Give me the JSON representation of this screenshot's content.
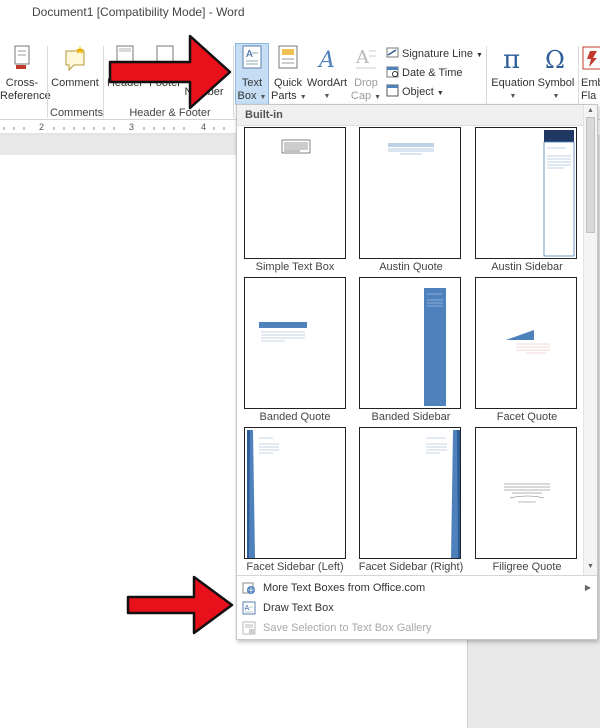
{
  "window": {
    "title": "Document1 [Compatibility Mode] - Word"
  },
  "ribbon": {
    "cross_reference": {
      "line1": "Cross-",
      "line2": "Reference"
    },
    "comment": {
      "label": "Comment"
    },
    "header": {
      "label": "Header"
    },
    "footer": {
      "label": "Footer"
    },
    "page_number": {
      "label": "Number"
    },
    "text_box": {
      "line1": "Text",
      "line2": "Box"
    },
    "quick_parts": {
      "line1": "Quick",
      "line2": "Parts"
    },
    "wordart": {
      "label": "WordArt"
    },
    "drop_cap": {
      "line1": "Drop",
      "line2": "Cap"
    },
    "signature_line": {
      "label": "Signature Line"
    },
    "date_time": {
      "label": "Date & Time"
    },
    "object": {
      "label": "Object"
    },
    "equation": {
      "label": "Equation"
    },
    "symbol": {
      "label": "Symbol"
    },
    "embed": {
      "line1": "Emb",
      "line2": "Fla"
    },
    "groups": {
      "comments": "Comments",
      "header_footer": "Header & Footer"
    }
  },
  "ruler": {
    "marks": [
      "2",
      "3",
      "4"
    ]
  },
  "gallery": {
    "section": "Built-in",
    "items": [
      {
        "label": "Simple Text Box"
      },
      {
        "label": "Austin Quote"
      },
      {
        "label": "Austin Sidebar"
      },
      {
        "label": "Banded Quote"
      },
      {
        "label": "Banded Sidebar"
      },
      {
        "label": "Facet Quote"
      },
      {
        "label": "Facet Sidebar (Left)"
      },
      {
        "label": "Facet Sidebar (Right)"
      },
      {
        "label": "Filigree Quote"
      }
    ],
    "menu": [
      {
        "label": "More Text Boxes from Office.com",
        "enabled": true
      },
      {
        "label": "Draw Text Box",
        "enabled": true
      },
      {
        "label": "Save Selection to Text Box Gallery",
        "enabled": false
      }
    ]
  },
  "colors": {
    "accent_blue": "#4f81bd",
    "selected_bg": "#c5def5",
    "arrow_red": "#e8101a"
  }
}
